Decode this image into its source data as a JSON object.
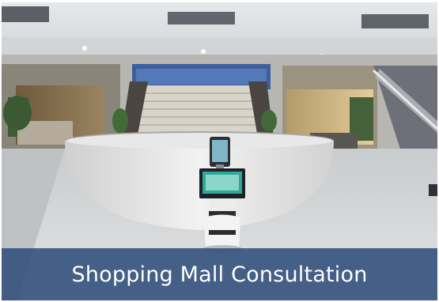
{
  "card": {
    "caption": "Shopping Mall Consultation",
    "caption_bar_color": "#34527c",
    "scene": {
      "depicts": [
        "mall-atrium",
        "central-staircase",
        "circular-reception-desk",
        "service-robot",
        "escalator"
      ]
    }
  }
}
